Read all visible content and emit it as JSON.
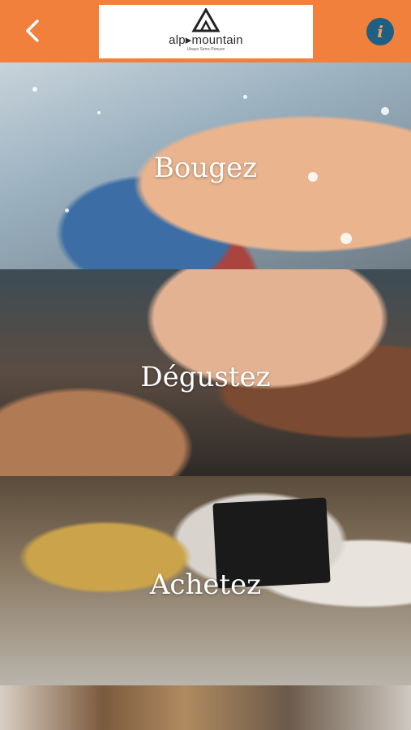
{
  "header": {
    "back_icon": "chevron-left-icon",
    "logo": {
      "text": "alp▸mountain",
      "subtitle": "Ubaye Serre-Ponçon"
    },
    "info_label": "i",
    "colors": {
      "bar": "#f0803c",
      "info_bg": "#1f5f82"
    }
  },
  "tiles": [
    {
      "label": "Bougez"
    },
    {
      "label": "Dégustez"
    },
    {
      "label": "Achetez"
    }
  ]
}
